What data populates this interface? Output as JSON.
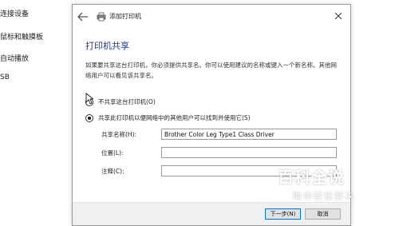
{
  "sidebar": {
    "items": [
      "连接设备",
      "鼠标和触摸板",
      "自动播放",
      "SB"
    ]
  },
  "dialog": {
    "title": "添加打印机",
    "heading": "打印机共享",
    "description": "如果要共享这台打印机，你必须提供共享名。你可以使用建议的名称或键入一个新名称。其他网络用户可以看见该共享名。",
    "radio_not_share": "不共享这台打印机(O)",
    "radio_share": "共享此打印机以便网络中的其他用户可以找到并使用它(S)",
    "share_name_label": "共享名称(H):",
    "share_name_value": "Brother Color Leg Type1 Class Driver",
    "location_label": "位置(L):",
    "location_value": "",
    "comment_label": "注释(C):",
    "comment_value": "",
    "next_button": "下一步(N)",
    "cancel_button": "取消"
  },
  "watermark": {
    "title": "百科全说",
    "subtitle": "助你轻松解决"
  },
  "colors": {
    "heading": "#1e3a8a",
    "primary_button_border": "#0078d7"
  }
}
